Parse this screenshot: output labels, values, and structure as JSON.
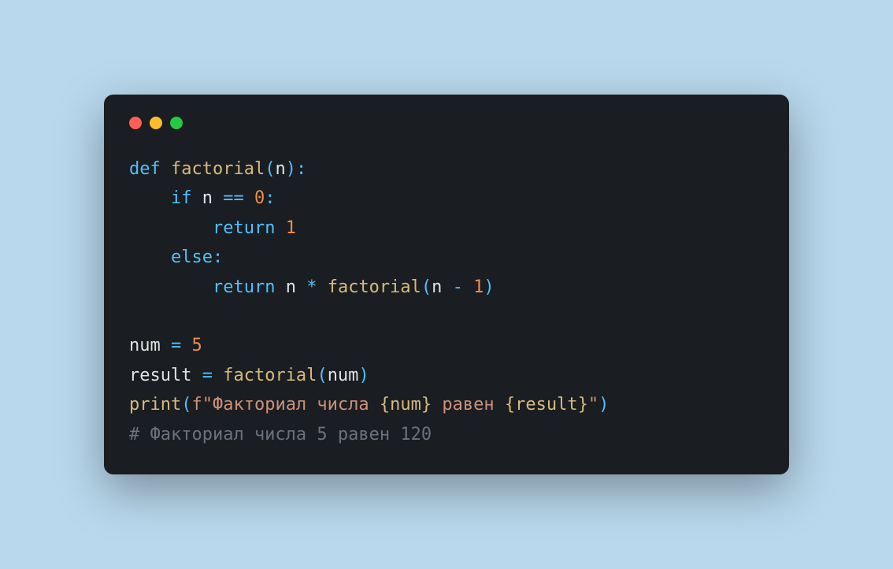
{
  "colors": {
    "background": "#b9d8ed",
    "window": "#1a1d21",
    "dot_red": "#ff5f56",
    "dot_yellow": "#ffbd2e",
    "dot_green": "#27c93f",
    "keyword": "#4fc1ff",
    "funcname": "#d7ba7d",
    "string": "#ce9178",
    "number": "#f08d4c",
    "default": "#e2e2e2",
    "comment": "#6a737d"
  },
  "code_lines": [
    [
      {
        "cls": "keyword",
        "text": "def"
      },
      {
        "cls": "default",
        "text": " "
      },
      {
        "cls": "funcname",
        "text": "factorial"
      },
      {
        "cls": "punct",
        "text": "("
      },
      {
        "cls": "default",
        "text": "n"
      },
      {
        "cls": "punct",
        "text": "):"
      }
    ],
    [
      {
        "cls": "default",
        "text": "    "
      },
      {
        "cls": "keyword",
        "text": "if"
      },
      {
        "cls": "default",
        "text": " n "
      },
      {
        "cls": "punct",
        "text": "=="
      },
      {
        "cls": "default",
        "text": " "
      },
      {
        "cls": "number",
        "text": "0"
      },
      {
        "cls": "punct",
        "text": ":"
      }
    ],
    [
      {
        "cls": "default",
        "text": "        "
      },
      {
        "cls": "keyword",
        "text": "return"
      },
      {
        "cls": "default",
        "text": " "
      },
      {
        "cls": "number",
        "text": "1"
      }
    ],
    [
      {
        "cls": "default",
        "text": "    "
      },
      {
        "cls": "keyword",
        "text": "else"
      },
      {
        "cls": "punct",
        "text": ":"
      }
    ],
    [
      {
        "cls": "default",
        "text": "        "
      },
      {
        "cls": "keyword",
        "text": "return"
      },
      {
        "cls": "default",
        "text": " n "
      },
      {
        "cls": "punct",
        "text": "*"
      },
      {
        "cls": "default",
        "text": " "
      },
      {
        "cls": "funcname",
        "text": "factorial"
      },
      {
        "cls": "punct",
        "text": "("
      },
      {
        "cls": "default",
        "text": "n "
      },
      {
        "cls": "punct",
        "text": "-"
      },
      {
        "cls": "default",
        "text": " "
      },
      {
        "cls": "number",
        "text": "1"
      },
      {
        "cls": "punct",
        "text": ")"
      }
    ],
    [
      {
        "cls": "default",
        "text": ""
      }
    ],
    [
      {
        "cls": "default",
        "text": "num "
      },
      {
        "cls": "punct",
        "text": "="
      },
      {
        "cls": "default",
        "text": " "
      },
      {
        "cls": "number",
        "text": "5"
      }
    ],
    [
      {
        "cls": "default",
        "text": "result "
      },
      {
        "cls": "punct",
        "text": "="
      },
      {
        "cls": "default",
        "text": " "
      },
      {
        "cls": "funcname",
        "text": "factorial"
      },
      {
        "cls": "punct",
        "text": "("
      },
      {
        "cls": "default",
        "text": "num"
      },
      {
        "cls": "punct",
        "text": ")"
      }
    ],
    [
      {
        "cls": "funcname",
        "text": "print"
      },
      {
        "cls": "punct",
        "text": "("
      },
      {
        "cls": "string",
        "text": "f\"Факториал числа "
      },
      {
        "cls": "string-interp",
        "text": "{num}"
      },
      {
        "cls": "string",
        "text": " равен "
      },
      {
        "cls": "string-interp",
        "text": "{result}"
      },
      {
        "cls": "string",
        "text": "\""
      },
      {
        "cls": "punct",
        "text": ")"
      }
    ],
    [
      {
        "cls": "comment",
        "text": "# Факториал числа 5 равен 120"
      }
    ]
  ]
}
